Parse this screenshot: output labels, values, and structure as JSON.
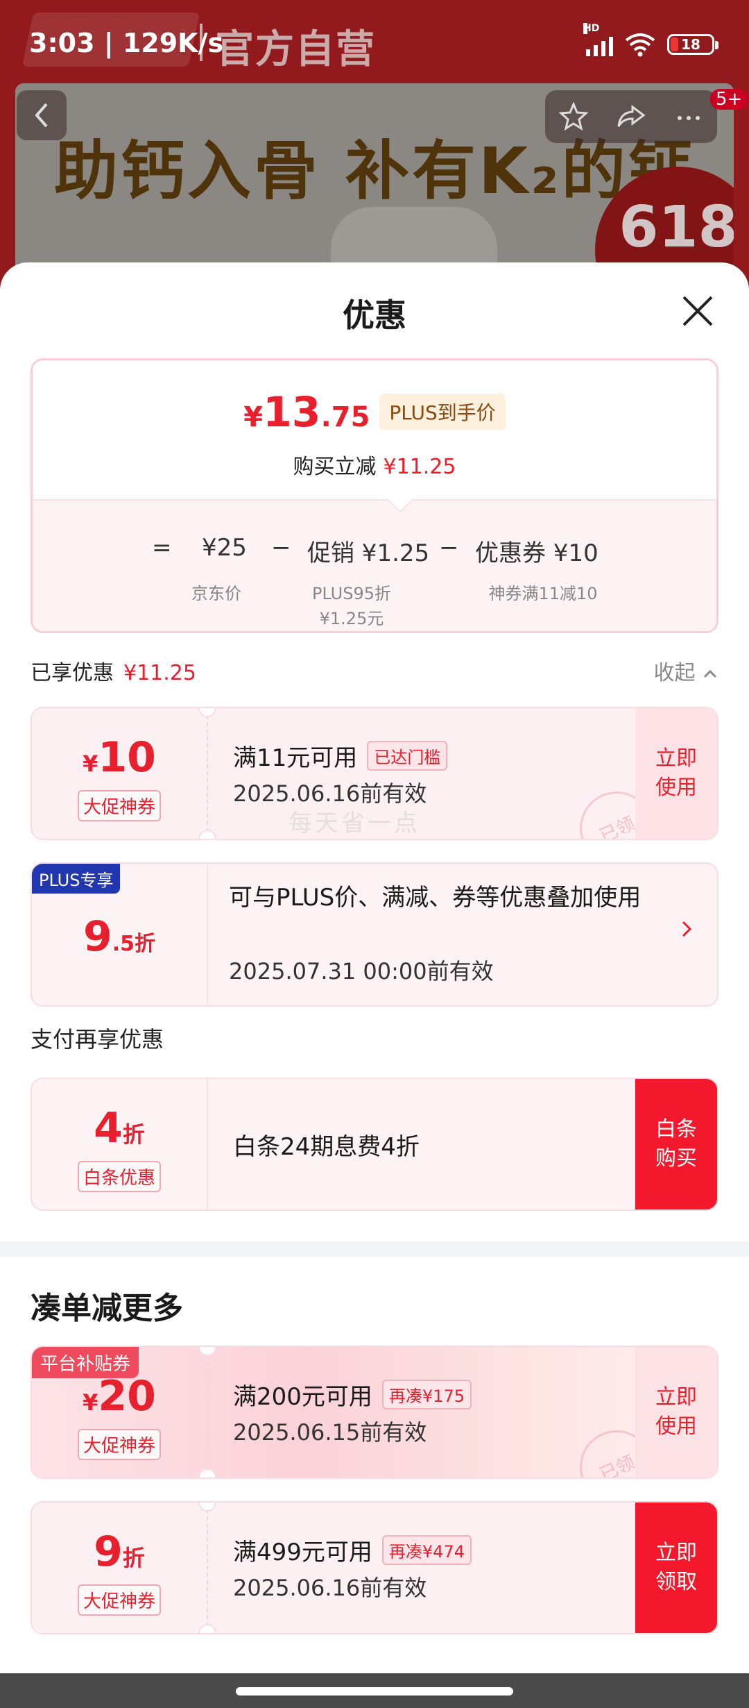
{
  "status_bar": {
    "time": "3:03 | 129K/s",
    "network_label": "HD",
    "battery": "18",
    "battery_level": 0.18
  },
  "background": {
    "store_name": "官方自营",
    "slogan": "助钙入骨 补有K₂的钙",
    "promo_badge": "618",
    "notification_count": "5+"
  },
  "sheet": {
    "title": "优惠"
  },
  "price_summary": {
    "currency": "¥",
    "final_int": "13",
    "final_dec": ".75",
    "plus_tag": "PLUS到手价",
    "reduce_label": "购买立减",
    "reduce_amount": "¥11.25",
    "equals": "=",
    "jd_price": "¥25",
    "minus1": "−",
    "promo": "促销 ¥1.25",
    "minus2": "−",
    "coupon": "优惠券 ¥10",
    "jd_price_label": "京东价",
    "promo_detail_1": "PLUS95折",
    "promo_detail_2": "¥1.25元",
    "coupon_detail": "神券满11减10"
  },
  "enjoyed": {
    "label": "已享优惠",
    "amount": "¥11.25",
    "collapse": "收起"
  },
  "coupons": [
    {
      "currency": "¥",
      "value": "10",
      "kind": "大促神券",
      "title": "满11元可用",
      "chip": "已达门槛",
      "expiry": "2025.06.16前有效",
      "button": "立即\n使用",
      "button_l1": "立即",
      "button_l2": "使用",
      "stamp": "已领",
      "watermark": "每天省一点"
    },
    {
      "discount": "9",
      "discount_dec": ".5折",
      "badge": "PLUS专享",
      "title": "可与PLUS价、满减、券等优惠叠加使用",
      "expiry": "2025.07.31 00:00前有效"
    }
  ],
  "payment_section": {
    "label": "支付再享优惠",
    "discount": "4",
    "unit": "折",
    "kind": "白条优惠",
    "title": "白条24期息费4折",
    "button_l1": "白条",
    "button_l2": "购买"
  },
  "more": {
    "title": "凑单减更多",
    "items": [
      {
        "tag": "平台补贴券",
        "currency": "¥",
        "value": "20",
        "kind": "大促神券",
        "title": "满200元可用",
        "chip": "再凑¥175",
        "expiry": "2025.06.15前有效",
        "button_l1": "立即",
        "button_l2": "使用",
        "stamp": "已领"
      },
      {
        "value": "9",
        "unit": "折",
        "kind": "大促神券",
        "title": "满499元可用",
        "chip": "再凑¥474",
        "expiry": "2025.06.16前有效",
        "button_l1": "立即",
        "button_l2": "领取"
      }
    ]
  },
  "colors": {
    "accent": "#e8202e",
    "plus_blue": "#2137b0",
    "button_red": "#f4182c"
  }
}
